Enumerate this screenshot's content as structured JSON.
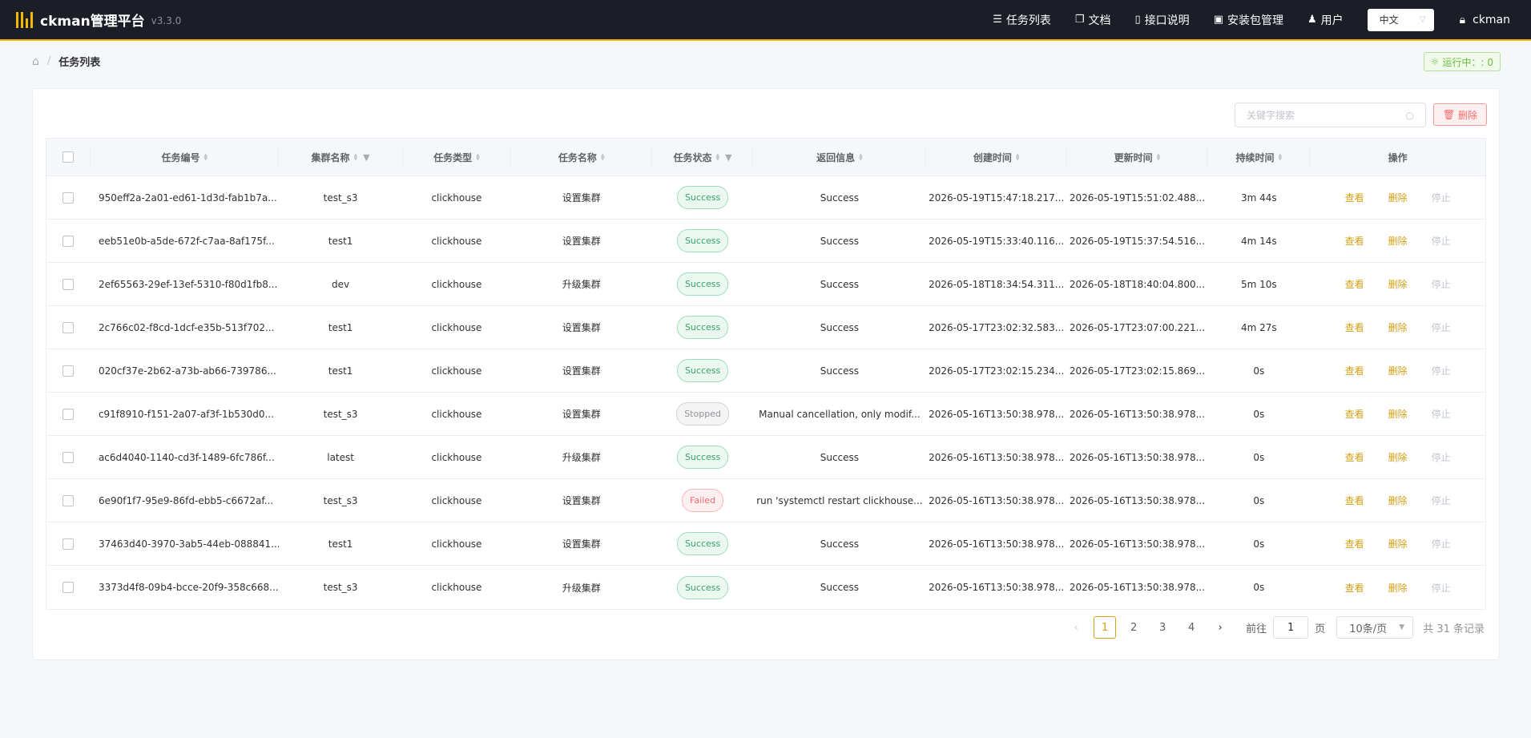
{
  "app": {
    "title": "ckman管理平台",
    "version": "v3.3.0"
  },
  "nav": {
    "items": [
      {
        "label": "任务列表",
        "icon": "list-icon"
      },
      {
        "label": "文档",
        "icon": "book-icon"
      },
      {
        "label": "接口说明",
        "icon": "file-icon"
      },
      {
        "label": "安装包管理",
        "icon": "briefcase-icon"
      },
      {
        "label": "用户",
        "icon": "users-icon"
      }
    ],
    "language": "中文",
    "username": "ckman"
  },
  "breadcrumb": {
    "current": "任务列表"
  },
  "status": {
    "running_label": "运行中：: 0"
  },
  "toolbar": {
    "search_placeholder": "关键字搜索",
    "delete_label": "删除"
  },
  "table": {
    "columns": [
      "任务编号",
      "集群名称",
      "任务类型",
      "任务名称",
      "任务状态",
      "返回信息",
      "创建时间",
      "更新时间",
      "持续时间",
      "操作"
    ],
    "actions": {
      "view": "查看",
      "delete": "删除",
      "stop": "停止"
    },
    "rows": [
      {
        "id": "950eff2a-2a01-ed61-1d3d-fab1b7a...",
        "cluster": "test_s3",
        "type": "clickhouse",
        "name": "设置集群",
        "status": "Success",
        "message": "Success",
        "created": "2026-05-19T15:47:18.217...",
        "updated": "2026-05-19T15:51:02.488...",
        "duration": "3m 44s"
      },
      {
        "id": "eeb51e0b-a5de-672f-c7aa-8af175f...",
        "cluster": "test1",
        "type": "clickhouse",
        "name": "设置集群",
        "status": "Success",
        "message": "Success",
        "created": "2026-05-19T15:33:40.116...",
        "updated": "2026-05-19T15:37:54.516...",
        "duration": "4m 14s"
      },
      {
        "id": "2ef65563-29ef-13ef-5310-f80d1fb8...",
        "cluster": "dev",
        "type": "clickhouse",
        "name": "升级集群",
        "status": "Success",
        "message": "Success",
        "created": "2026-05-18T18:34:54.311...",
        "updated": "2026-05-18T18:40:04.800...",
        "duration": "5m 10s"
      },
      {
        "id": "2c766c02-f8cd-1dcf-e35b-513f702...",
        "cluster": "test1",
        "type": "clickhouse",
        "name": "设置集群",
        "status": "Success",
        "message": "Success",
        "created": "2026-05-17T23:02:32.583...",
        "updated": "2026-05-17T23:07:00.221...",
        "duration": "4m 27s"
      },
      {
        "id": "020cf37e-2b62-a73b-ab66-739786...",
        "cluster": "test1",
        "type": "clickhouse",
        "name": "设置集群",
        "status": "Success",
        "message": "Success",
        "created": "2026-05-17T23:02:15.234...",
        "updated": "2026-05-17T23:02:15.869...",
        "duration": "0s"
      },
      {
        "id": "c91f8910-f151-2a07-af3f-1b530d0...",
        "cluster": "test_s3",
        "type": "clickhouse",
        "name": "设置集群",
        "status": "Stopped",
        "message": "Manual cancellation, only modif...",
        "created": "2026-05-16T13:50:38.978...",
        "updated": "2026-05-16T13:50:38.978...",
        "duration": "0s"
      },
      {
        "id": "ac6d4040-1140-cd3f-1489-6fc786f...",
        "cluster": "latest",
        "type": "clickhouse",
        "name": "升级集群",
        "status": "Success",
        "message": "Success",
        "created": "2026-05-16T13:50:38.978...",
        "updated": "2026-05-16T13:50:38.978...",
        "duration": "0s"
      },
      {
        "id": "6e90f1f7-95e9-86fd-ebb5-c6672af...",
        "cluster": "test_s3",
        "type": "clickhouse",
        "name": "设置集群",
        "status": "Failed",
        "message": "run 'systemctl restart clickhouse...",
        "created": "2026-05-16T13:50:38.978...",
        "updated": "2026-05-16T13:50:38.978...",
        "duration": "0s"
      },
      {
        "id": "37463d40-3970-3ab5-44eb-088841...",
        "cluster": "test1",
        "type": "clickhouse",
        "name": "设置集群",
        "status": "Success",
        "message": "Success",
        "created": "2026-05-16T13:50:38.978...",
        "updated": "2026-05-16T13:50:38.978...",
        "duration": "0s"
      },
      {
        "id": "3373d4f8-09b4-bcce-20f9-358c668...",
        "cluster": "test_s3",
        "type": "clickhouse",
        "name": "升级集群",
        "status": "Success",
        "message": "Success",
        "created": "2026-05-16T13:50:38.978...",
        "updated": "2026-05-16T13:50:38.978...",
        "duration": "0s"
      }
    ]
  },
  "pagination": {
    "pages": [
      "1",
      "2",
      "3",
      "4"
    ],
    "current": "1",
    "goto_prefix": "前往",
    "goto_value": "1",
    "goto_suffix": "页",
    "page_size": "10条/页",
    "total": "共 31 条记录"
  },
  "colors": {
    "header_bg": "#1b1e27",
    "accent": "#f5b800",
    "success": "#3aa16b",
    "danger": "#f56c6c"
  }
}
